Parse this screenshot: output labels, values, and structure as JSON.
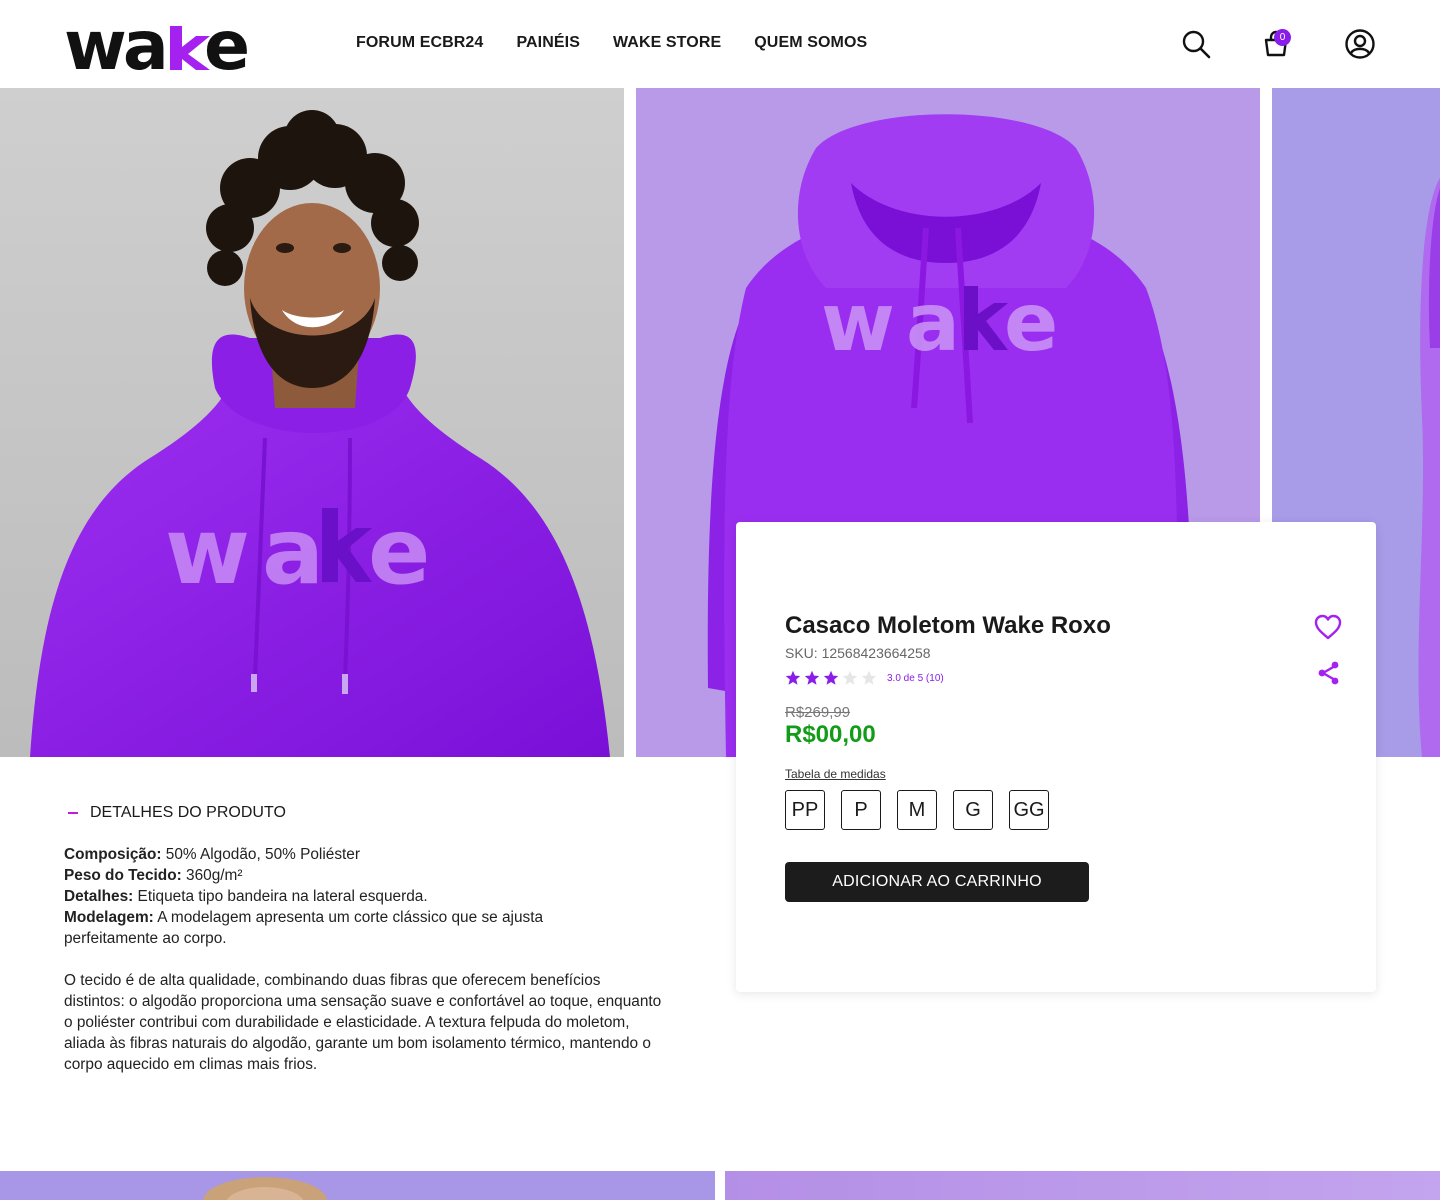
{
  "brand": {
    "logo_text": "wake",
    "accent": "#8a1de8",
    "logo_k_accent": "#a421f0"
  },
  "nav": {
    "items": [
      {
        "label": "FORUM ECBR24"
      },
      {
        "label": "PAINÉIS"
      },
      {
        "label": "WAKE STORE"
      },
      {
        "label": "QUEM SOMOS"
      }
    ]
  },
  "header_icons": {
    "search": "search-icon",
    "cart": "shopping-bag-icon",
    "cart_count": "0",
    "account": "user-circle-icon"
  },
  "gallery": {
    "images": [
      {
        "name": "model-wearing-hoodie",
        "print": "wake"
      },
      {
        "name": "hoodie-front-view",
        "print": "wake"
      },
      {
        "name": "model-side-view"
      }
    ]
  },
  "product": {
    "title": "Casaco Moletom Wake Roxo",
    "sku": "SKU: 12568423664258",
    "rating": {
      "value": 3,
      "max": 5,
      "text": "3.0 de 5 (10)"
    },
    "old_price": "R$269,99",
    "price": "R$00,00",
    "price_color": "#129c18",
    "size_table_link": "Tabela de medidas",
    "sizes": [
      "PP",
      "P",
      "M",
      "G",
      "GG"
    ],
    "add_to_cart": "ADICIONAR AO CARRINHO",
    "favorite_icon": "heart-icon",
    "share_icon": "share-icon"
  },
  "details": {
    "heading": "DETALHES DO PRODUTO",
    "specs": [
      {
        "label": "Composição:",
        "value": " 50% Algodão, 50% Poliéster"
      },
      {
        "label": "Peso do Tecido:",
        "value": " 360g/m²"
      },
      {
        "label": "Detalhes:",
        "value": " Etiqueta tipo bandeira na lateral esquerda."
      },
      {
        "label": "Modelagem:",
        "value": " A modelagem apresenta um corte clássico que se ajusta perfeitamente ao corpo."
      }
    ],
    "description": "O tecido é de alta qualidade, combinando duas fibras que oferecem benefícios distintos: o algodão proporciona uma sensação suave e confortável ao toque, enquanto o poliéster contribui com durabilidade e elasticidade. A textura felpuda do moletom, aliada às fibras naturais do algodão, garante um bom isolamento térmico, mantendo o corpo aquecido em climas mais frios."
  }
}
